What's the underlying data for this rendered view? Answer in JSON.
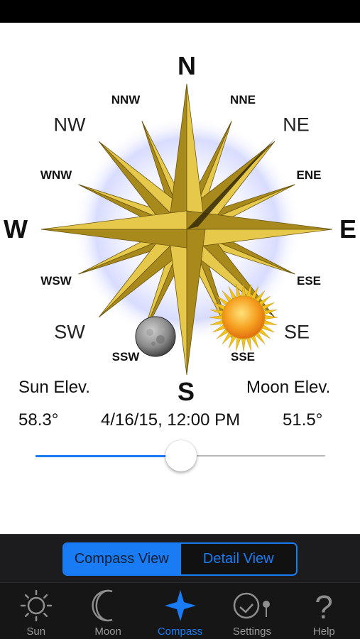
{
  "compass": {
    "directions": {
      "n": "N",
      "s": "S",
      "e": "E",
      "w": "W",
      "ne": "NE",
      "nw": "NW",
      "se": "SE",
      "sw": "SW",
      "nne": "NNE",
      "nnw": "NNW",
      "ene": "ENE",
      "wnw": "WNW",
      "ese": "ESE",
      "wsw": "WSW",
      "sse": "SSE",
      "ssw": "SSW"
    },
    "sun_icon": "sun-icon",
    "moon_icon": "moon-icon"
  },
  "info": {
    "sun_elev_label": "Sun Elev.",
    "moon_elev_label": "Moon Elev.",
    "sun_elev_value": "58.3°",
    "moon_elev_value": "51.5°",
    "datetime": "4/16/15, 12:00 PM"
  },
  "time_slider": {
    "value": 0.5
  },
  "view_toggle": {
    "compass_view": "Compass View",
    "detail_view": "Detail View",
    "selected": "Compass View"
  },
  "tabbar": {
    "sun": "Sun",
    "moon": "Moon",
    "compass": "Compass",
    "settings": "Settings",
    "help": "Help",
    "active": "Compass"
  },
  "colors": {
    "accent": "#1a7cf5",
    "compass_gold": "#e6c84a",
    "compass_dark_gold": "#a8891c"
  }
}
